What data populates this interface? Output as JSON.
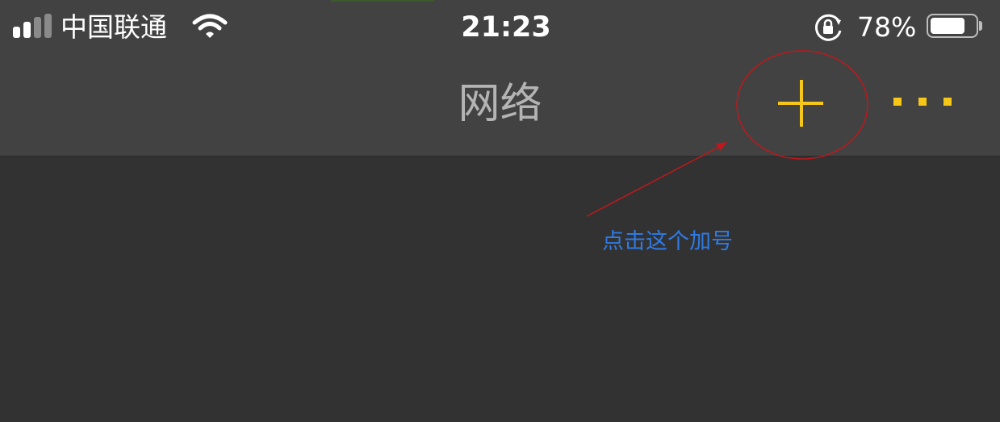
{
  "status_bar": {
    "carrier": "中国联通",
    "time": "21:23",
    "battery_percent": "78%",
    "battery_level": 0.78,
    "signal_bars_filled": 2,
    "signal_bars_total": 4,
    "icons": [
      "cellular-signal-icon",
      "wifi-icon",
      "rotation-lock-icon",
      "battery-icon"
    ]
  },
  "nav_bar": {
    "title": "网络",
    "add_icon": "plus-icon",
    "more_icon": "more-dots-icon",
    "accent_color": "#f6c619"
  },
  "annotation": {
    "hint": "点击这个加号",
    "hint_color": "#2f7be6",
    "circle_color": "#c0181c"
  }
}
